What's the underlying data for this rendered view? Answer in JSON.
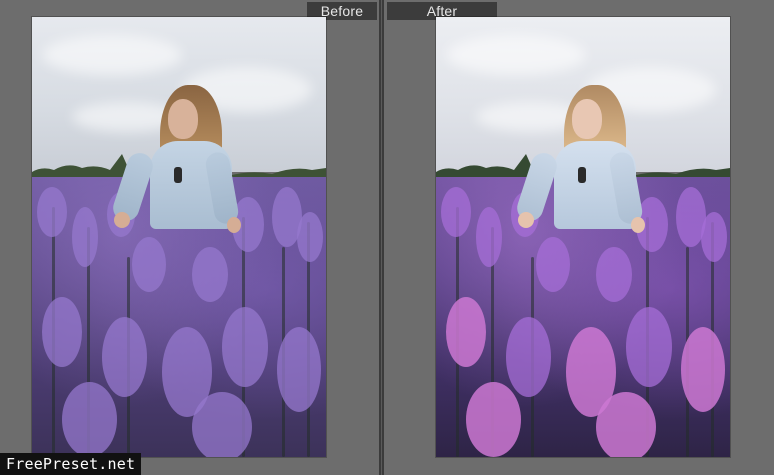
{
  "compare": {
    "before_label": "Before",
    "after_label": "After"
  },
  "watermark": {
    "text": "FreePreset.net"
  },
  "colors": {
    "background": "#6f6f6f",
    "divider": "#3b3b3b",
    "label_bg": "#3c3c3c",
    "label_text": "#e6e6e6",
    "watermark_bg": "#111111",
    "watermark_text": "#ffffff"
  },
  "photo": {
    "subject": "woman-in-lavender-field-image"
  }
}
